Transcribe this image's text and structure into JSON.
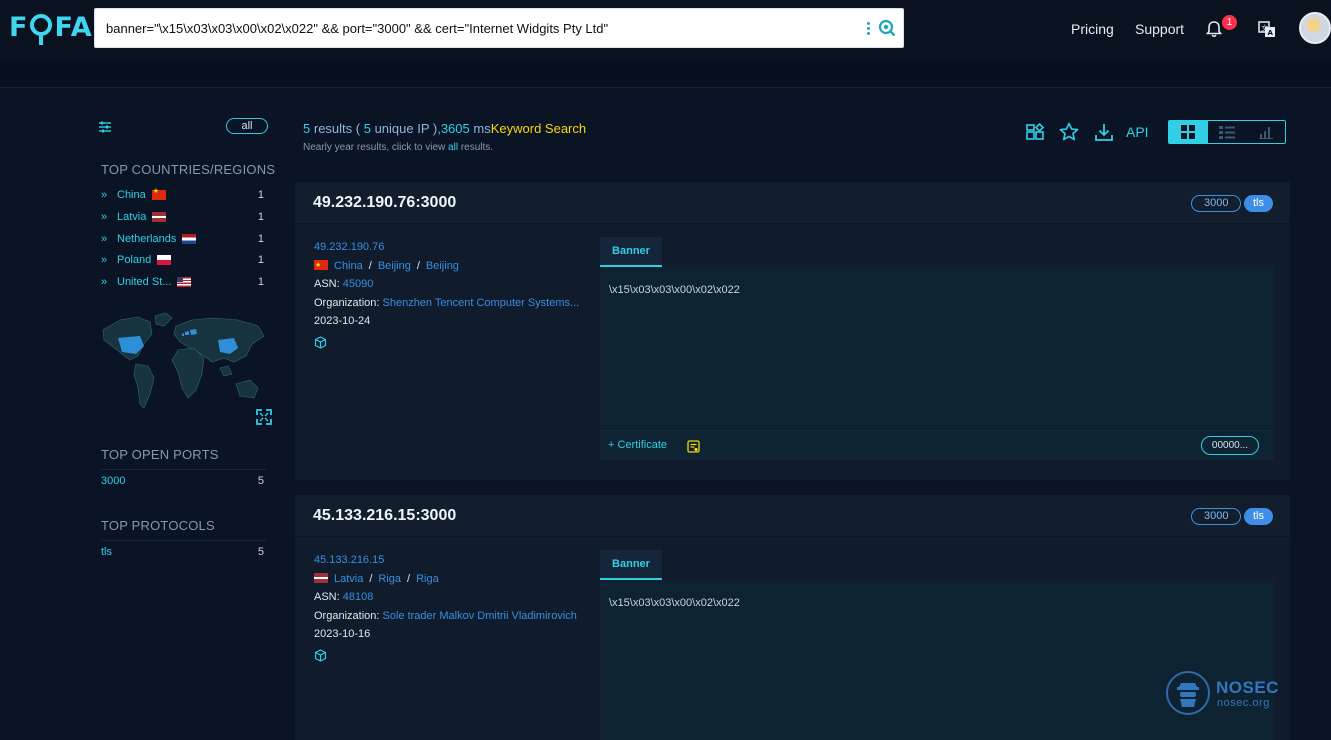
{
  "header": {
    "logo": "FOFA",
    "search_query": "banner=\"\\x15\\x03\\x03\\x00\\x02\\x022\" && port=\"3000\" && cert=\"Internet Widgits Pty Ltd\"",
    "nav": [
      "Pricing",
      "Support"
    ],
    "notification_count": "1"
  },
  "sidebar": {
    "all_label": "all",
    "countries_title": "TOP COUNTRIES/REGIONS",
    "countries": [
      {
        "name": "China",
        "count": "1",
        "flag": "cn"
      },
      {
        "name": "Latvia",
        "count": "1",
        "flag": "lv"
      },
      {
        "name": "Netherlands",
        "count": "1",
        "flag": "nl"
      },
      {
        "name": "Poland",
        "count": "1",
        "flag": "pl"
      },
      {
        "name": "United St...",
        "count": "1",
        "flag": "us"
      }
    ],
    "ports_title": "TOP OPEN PORTS",
    "ports": [
      {
        "port": "3000",
        "count": "5"
      }
    ],
    "protocols_title": "TOP PROTOCOLS",
    "protocols": [
      {
        "name": "tls",
        "count": "5"
      }
    ]
  },
  "summary": {
    "results": "5",
    "results_label": "results (",
    "unique_ip": "5",
    "unique_ip_label": "unique IP )",
    "time": ",3605",
    "time_unit": "ms",
    "keyword": "Keyword Search",
    "sub_prefix": "Nearly year results, click to view",
    "sub_link": "all",
    "sub_suffix": "results.",
    "api_label": "API"
  },
  "results": [
    {
      "title": "49.232.190.76:3000",
      "port_tag": "3000",
      "protocol_tag": "tls",
      "ip": "49.232.190.76",
      "country": "China",
      "region": "Beijing",
      "city": "Beijing",
      "asn_label": "ASN:",
      "asn": "45090",
      "org_label": "Organization:",
      "organization": "Shenzhen Tencent Computer Systems...",
      "date": "2023-10-24",
      "tab": "Banner",
      "banner": "\\x15\\x03\\x03\\x00\\x02\\x022",
      "cert_label": "Certificate",
      "cert_value": "00000..."
    },
    {
      "title": "45.133.216.15:3000",
      "port_tag": "3000",
      "protocol_tag": "tls",
      "ip": "45.133.216.15",
      "country": "Latvia",
      "region": "Riga",
      "city": "Riga",
      "asn_label": "ASN:",
      "asn": "48108",
      "org_label": "Organization:",
      "organization": "Sole trader Malkov Dmitrii Vladimirovich",
      "date": "2023-10-16",
      "tab": "Banner",
      "banner": "\\x15\\x03\\x03\\x00\\x02\\x022"
    }
  ],
  "watermark": {
    "name": "NOSEC",
    "url": "nosec.org"
  },
  "colors": {
    "accent": "#30cfe6",
    "link": "#3a8fe0",
    "keyword": "#f5d90a",
    "background": "#0b1424"
  }
}
